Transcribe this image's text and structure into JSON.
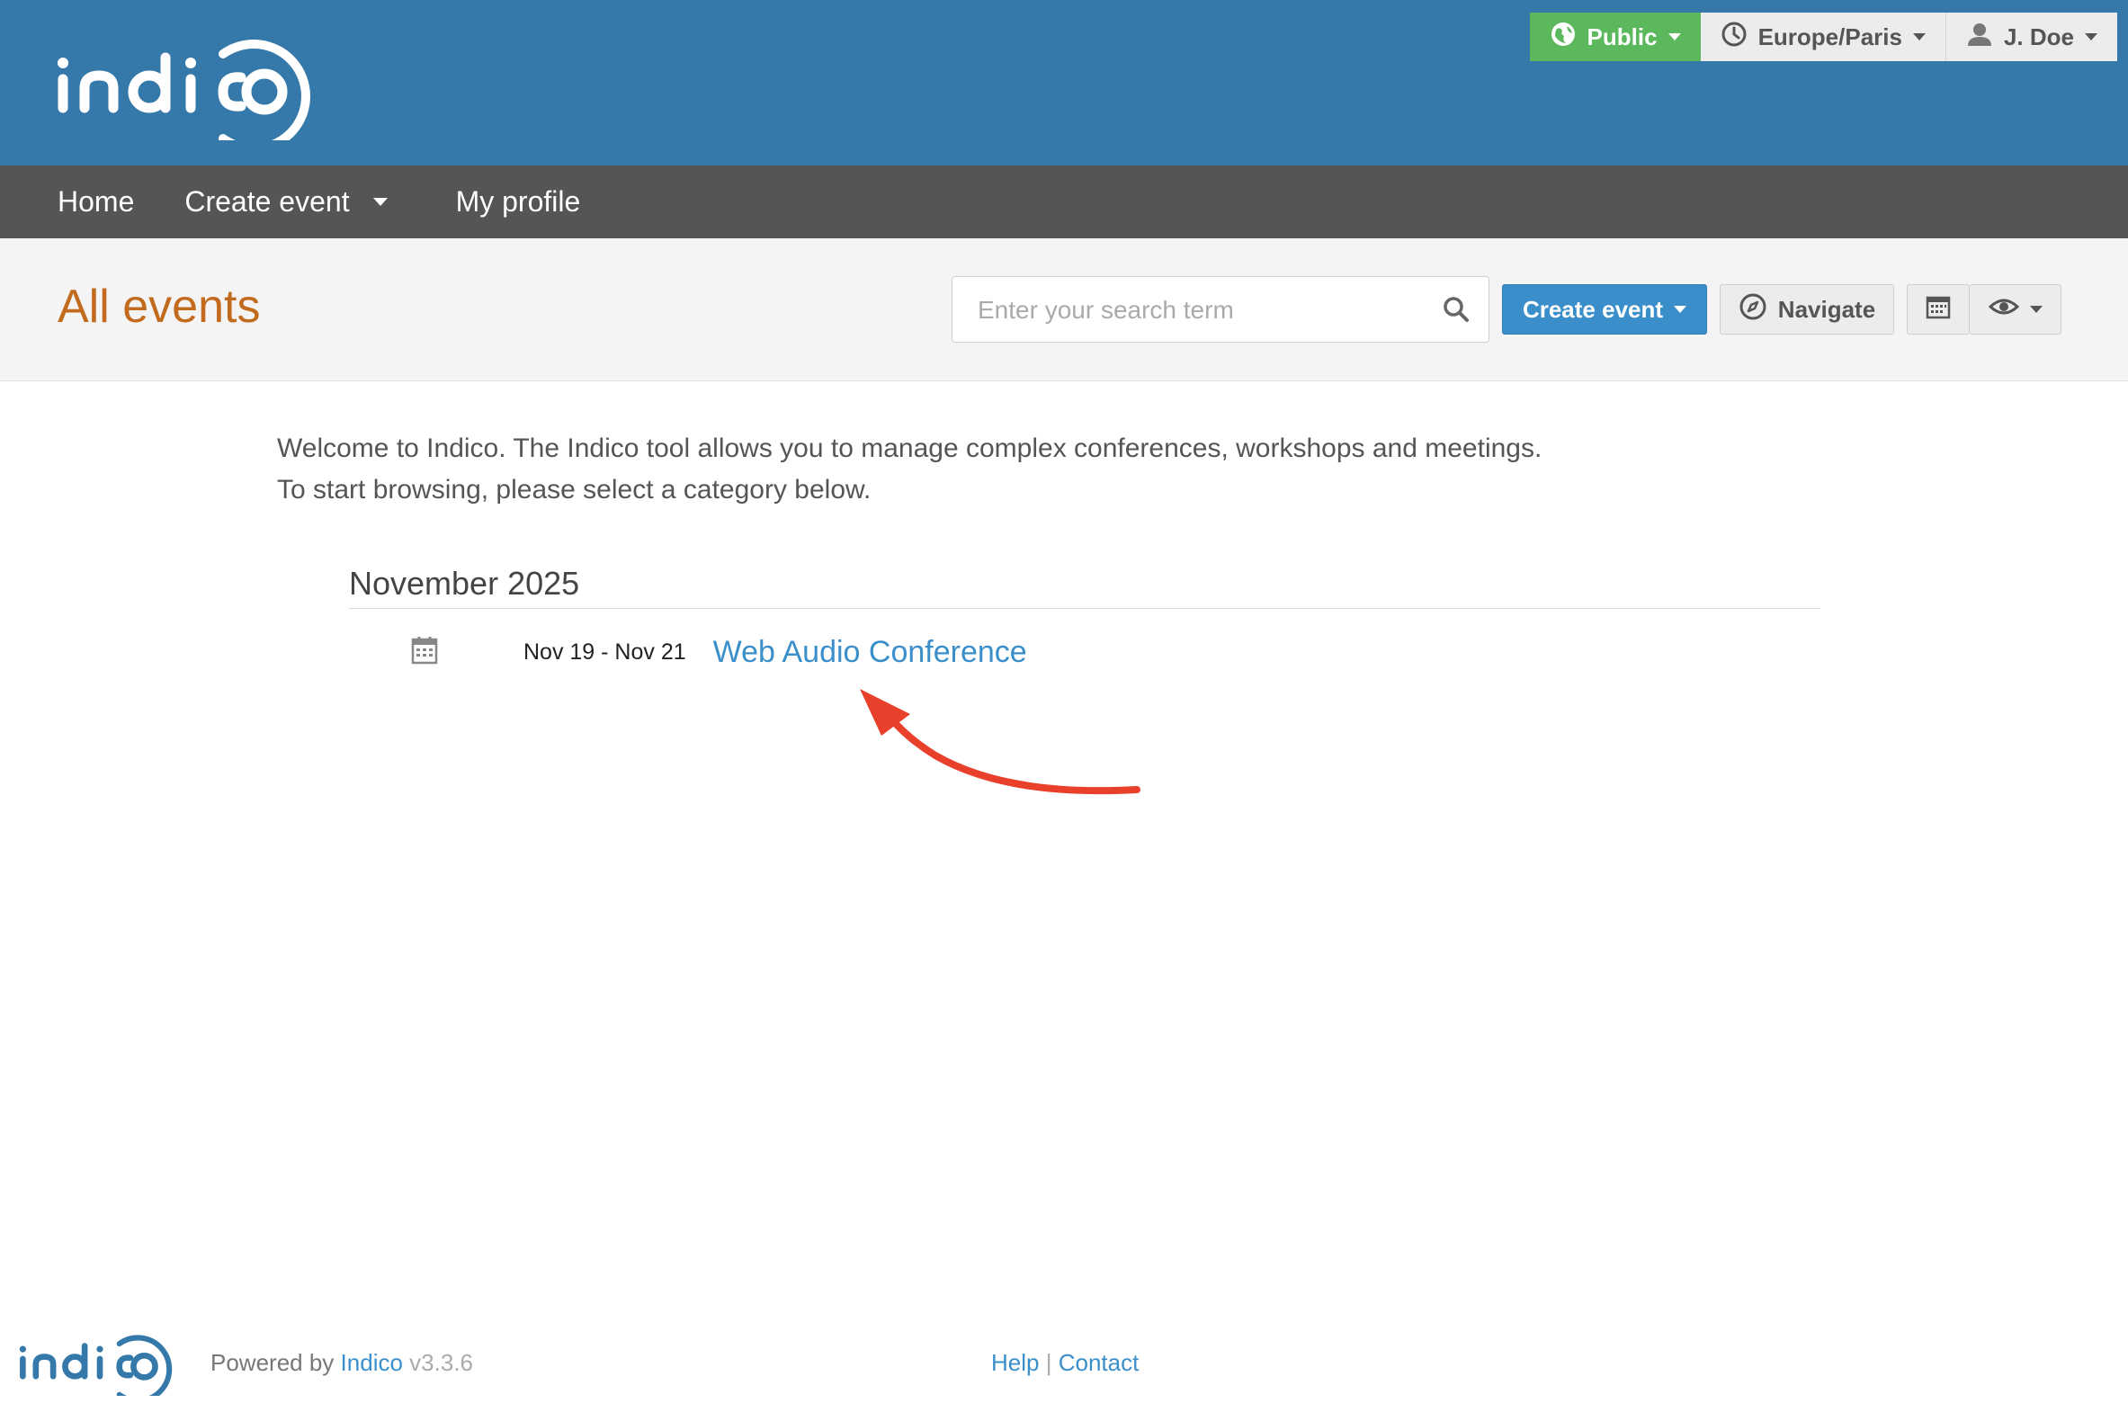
{
  "header": {
    "logo_text": "indico",
    "privacy_label": "Public",
    "timezone_label": "Europe/Paris",
    "user_label": "J. Doe"
  },
  "nav": {
    "items": [
      {
        "label": "Home"
      },
      {
        "label": "Create event"
      },
      {
        "label": "My profile"
      }
    ]
  },
  "titlebar": {
    "title": "All events",
    "search_placeholder": "Enter your search term",
    "create_event_label": "Create event",
    "navigate_label": "Navigate"
  },
  "content": {
    "welcome_line1": "Welcome to Indico. The Indico tool allows you to manage complex conferences, workshops and meetings.",
    "welcome_line2": "To start browsing, please select a category below.",
    "month": "November 2025",
    "events": [
      {
        "dates": "Nov 19 - Nov 21",
        "title": "Web Audio Conference"
      }
    ]
  },
  "footer": {
    "powered_prefix": "Powered by",
    "powered_link": "Indico",
    "version": "v3.3.6",
    "help": "Help",
    "separator": "|",
    "contact": "Contact"
  },
  "colors": {
    "header_blue": "#3579aa",
    "nav_gray": "#555555",
    "title_orange": "#c26a1e",
    "link_blue": "#3a8fcb",
    "public_green": "#5cb85c",
    "annotation_red": "#e8402a"
  }
}
